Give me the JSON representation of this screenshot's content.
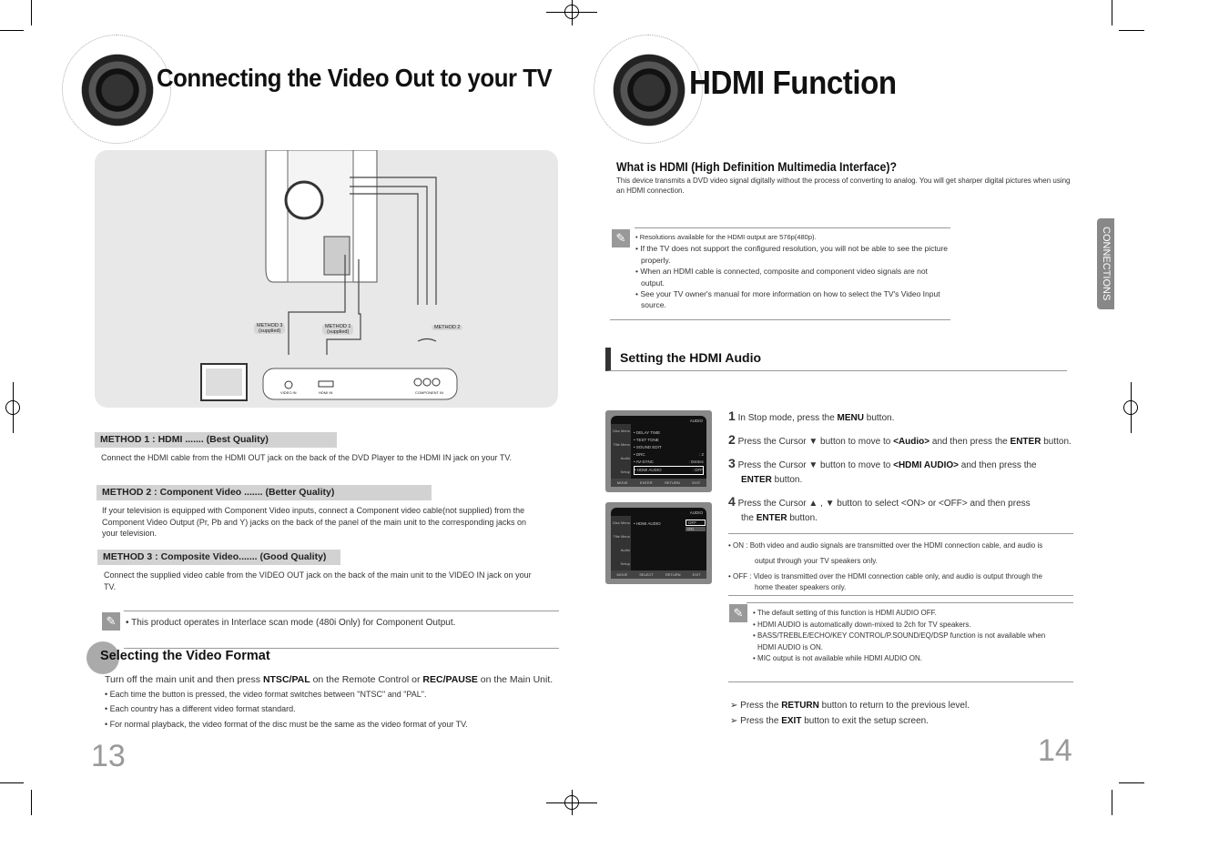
{
  "left_page": {
    "title": "Connecting the Video Out to your TV",
    "diagram": {
      "method3": "METHOD 3",
      "method3_sub": "(supplied)",
      "method1": "METHOD 1",
      "method1_sub": "(supplied)",
      "method2": "METHOD 2",
      "jack_video": "VIDEO IN",
      "jack_hdmi": "HDMI IN",
      "jack_component": "COMPONENT IN"
    },
    "methods": [
      {
        "heading": "METHOD 1 : HDMI ....... (Best Quality)",
        "text": "Connect the HDMI cable from the HDMI OUT jack on the back of the DVD Player to the HDMI IN jack on your TV."
      },
      {
        "heading": "METHOD 2 : Component Video ....... (Better Quality)",
        "text": "If your television is equipped with Component Video inputs, connect a Component video cable(not supplied) from the Component Video Output (Pr, Pb and Y) jacks on the back of the panel of the main unit to the corresponding jacks on your television."
      },
      {
        "heading": "METHOD 3 : Composite Video....... (Good Quality)",
        "text": "Connect the supplied video cable from the VIDEO OUT jack on the back of the main unit to the VIDEO IN jack on your TV."
      }
    ],
    "note": "• This product operates in Interlace scan mode (480i Only) for Component Output.",
    "format_heading": "Selecting the Video Format",
    "format_intro_pre": "Turn off the main unit and then press ",
    "format_intro_b1": "NTSC/PAL",
    "format_intro_mid": " on the Remote Control or ",
    "format_intro_b2": "REC/PAUSE",
    "format_intro_post": " on the Main Unit.",
    "format_bullets": [
      "Each time the button is pressed, the video format switches between \"NTSC\" and \"PAL\".",
      "Each country has a different video format standard.",
      "For normal playback, the video format of the disc must be the same as the video format of your TV."
    ],
    "page_number": "13"
  },
  "right_page": {
    "title": "HDMI Function",
    "what_heading": "What is HDMI (High Definition Multimedia Interface)?",
    "what_text": "This device transmits a DVD video signal digitally without the process of converting to analog. You will get sharper digital pictures when using an HDMI connection.",
    "notes1": [
      "• Resolutions available for the HDMI output are 576p(480p).",
      "• If the TV does not support the configured resolution, you will not be able to see the picture properly.",
      "• When an HDMI cable is connected, composite and component video signals are not output.",
      "• See your TV owner's manual for more information on how to select the TV's Video Input source."
    ],
    "audio_heading": "Setting the HDMI Audio",
    "side_tab": "CONNECTIONS",
    "screen1": {
      "header": "AUDIO",
      "menu": [
        "Disc Menu",
        "Title Menu",
        "Audio",
        "Setup"
      ],
      "items": [
        "• DELAY TIME",
        "• TEST TONE",
        "• SOUND EDIT",
        "• DRC",
        "• AV-SYNC",
        "• HDMI AUDIO"
      ],
      "values": [
        "",
        "",
        "",
        ": 2",
        ": 0mSec",
        ": OFF"
      ],
      "footer": [
        "MOVE",
        "ENTER",
        "RETURN",
        "EXIT"
      ]
    },
    "screen2": {
      "header": "AUDIO",
      "menu": [
        "Disc Menu",
        "Title Menu",
        "Audio",
        "Setup"
      ],
      "item": "• HDMI AUDIO",
      "options": [
        "OFF",
        "ON"
      ],
      "footer": [
        "MOVE",
        "SELECT",
        "RETURN",
        "EXIT"
      ]
    },
    "steps": [
      {
        "n": "1",
        "pre": "In Stop mode, press the ",
        "b": "MENU",
        "post": " button.",
        "pre2": "",
        "b2": "",
        "post2": ""
      },
      {
        "n": "2",
        "pre": "Press the Cursor ▼ button to move to ",
        "b": "<Audio>",
        "post": " and then press the ",
        "b2": "ENTER",
        "post2": " button."
      },
      {
        "n": "3",
        "pre": "Press the Cursor ▼ button to move to ",
        "b": "<HDMI AUDIO>",
        "post": " and then press the ",
        "b2": "ENTER",
        "post2": " button."
      },
      {
        "n": "4",
        "pre": "Press the Cursor ▲ , ▼ button to select <ON> or <OFF> and then press the ",
        "b": "ENTER",
        "post": " button.",
        "b2": "",
        "post2": ""
      }
    ],
    "on_off": [
      "• ON : Both video and audio signals are transmitted over the HDMI connection cable, and audio is output through your TV speakers only.",
      "• OFF : Video is transmitted over the HDMI connection cable only, and audio is output through the home theater speakers only."
    ],
    "notes2": [
      "• The default setting of this function is HDMI AUDIO OFF.",
      "• HDMI AUDIO is automatically down-mixed to 2ch for TV speakers.",
      "• BASS/TREBLE/ECHO/KEY CONTROL/P.SOUND/EQ/DSP function is not available when HDMI AUDIO is ON.",
      "• MIC output is not available while HDMI AUDIO ON."
    ],
    "tips": [
      {
        "pre": "Press the ",
        "b": "RETURN",
        "post": " button to return to the previous level."
      },
      {
        "pre": "Press the ",
        "b": "EXIT",
        "post": " button to exit the setup screen."
      }
    ],
    "page_number": "14"
  },
  "colors": {
    "accent_gray": "#d2d2d2",
    "side_tab": "#888888",
    "heading_bar": "#333333"
  },
  "icons": [
    "speaker-graphic",
    "note-pencil-icon",
    "arrow-tip-icon",
    "crop-mark"
  ]
}
